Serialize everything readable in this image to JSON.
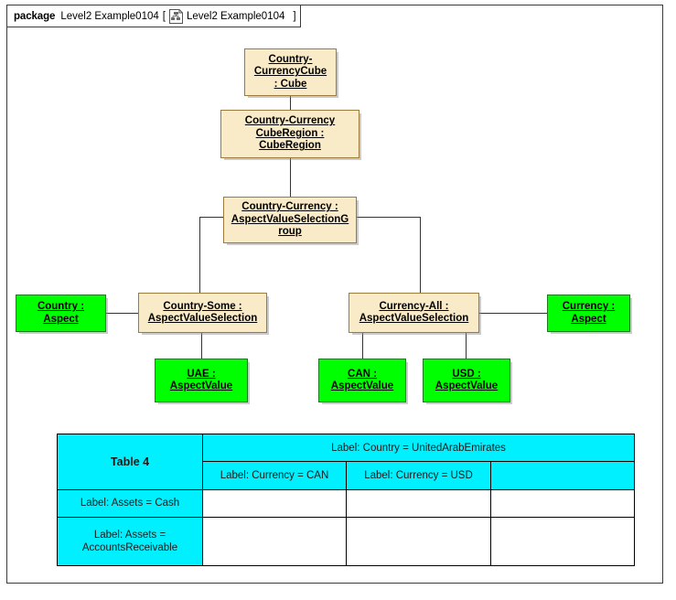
{
  "package": {
    "keyword": "package",
    "name": "Level2 Example0104",
    "bracket_open": "[",
    "diagram_icon": "hierarchy-diagram-icon",
    "diagram_name": "Level2 Example0104",
    "bracket_close": "]"
  },
  "colors": {
    "class_fill": "#FAEBC8",
    "class_border": "#9C7A3C",
    "aspect_fill": "#00FF00",
    "aspect_border": "#1E7A1E",
    "table_header_fill": "#00F0FF",
    "line": "#333333",
    "frame": "#3A3A3A"
  },
  "nodes": {
    "cube": {
      "line1": "Country-",
      "line2": "CurrencyCube",
      "line3": ": Cube",
      "full": "Country-CurrencyCube : Cube",
      "kind": "class"
    },
    "cube_region": {
      "line1": "Country-Currency",
      "line2": "CubeRegion :",
      "line3": "CubeRegion",
      "full": "Country-Currency CubeRegion : CubeRegion",
      "kind": "class"
    },
    "avs_group": {
      "line1": "Country-Currency :",
      "line2": "AspectValueSelectionG",
      "line3": "roup",
      "full": "Country-Currency : AspectValueSelectionGroup",
      "kind": "class"
    },
    "country_aspect": {
      "line1": "Country :",
      "line2": "Aspect",
      "full": "Country : Aspect",
      "kind": "aspect"
    },
    "country_some": {
      "line1": "Country-Some :",
      "line2": "AspectValueSelection",
      "full": "Country-Some : AspectValueSelection",
      "kind": "class"
    },
    "currency_all": {
      "line1": "Currency-All :",
      "line2": "AspectValueSelection",
      "full": "Currency-All : AspectValueSelection",
      "kind": "class"
    },
    "currency_aspect": {
      "line1": "Currency :",
      "line2": "Aspect",
      "full": "Currency : Aspect",
      "kind": "aspect"
    },
    "uae": {
      "line1": "UAE :",
      "line2": "AspectValue",
      "full": "UAE : AspectValue",
      "kind": "aspect"
    },
    "can": {
      "line1": "CAN :",
      "line2": "AspectValue",
      "full": "CAN : AspectValue",
      "kind": "aspect"
    },
    "usd": {
      "line1": "USD :",
      "line2": "AspectValue",
      "full": "USD : AspectValue",
      "kind": "aspect"
    }
  },
  "table": {
    "title": "Table 4",
    "country_header": "Label: Country = UnitedArabEmirates",
    "currency_headers": [
      "Label: Currency = CAN",
      "Label: Currency = USD",
      ""
    ],
    "row_headers": [
      "Label: Assets = Cash",
      "Label: Assets = AccountsReceivable"
    ],
    "cells": [
      [
        "",
        "",
        ""
      ],
      [
        "",
        "",
        ""
      ]
    ]
  }
}
